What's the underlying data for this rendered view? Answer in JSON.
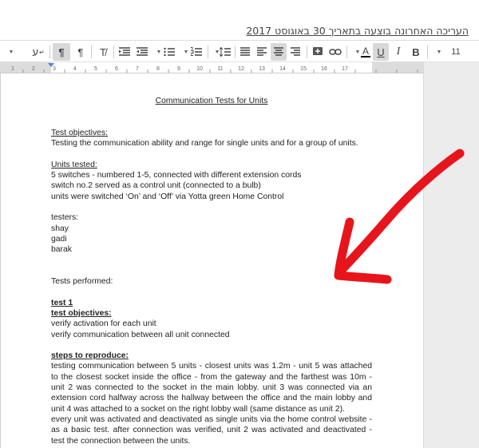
{
  "header": {
    "last_edit": "העריכה האחרונה בוצעה בתאריך 30 באוגוסט 2017"
  },
  "toolbar": {
    "font_size": "11",
    "bold": "B",
    "italic": "I",
    "underline": "U",
    "text_color": "A",
    "rtl": "ע",
    "pilcrow": "¶"
  },
  "ruler": {
    "markers": [
      "1",
      "2",
      "3",
      "4",
      "5",
      "6",
      "7",
      "8",
      "9",
      "10",
      "11",
      "12",
      "13",
      "14",
      "15",
      "16",
      "17"
    ]
  },
  "document": {
    "title": "Communication Tests for Units",
    "objectives_heading": "Test objectives:",
    "objectives_text": "Testing the communication ability and range for single units and for a group of units.",
    "units_heading": "Units tested:",
    "units_lines": [
      "5 switches - numbered 1-5, connected with different extension cords",
      "switch no.2 served as a control unit (connected to a bulb)",
      "units were switched ‘On’ and ‘Off’ via Yotta green Home Control"
    ],
    "testers_heading": "testers:",
    "testers": [
      "shay",
      "gadi",
      "barak"
    ],
    "performed_heading": "Tests performed:",
    "test1_heading": "test 1",
    "test1_objectives_heading": "test objectives:",
    "test1_objectives": [
      "verify activation for each unit",
      "verify communication between all unit connected"
    ],
    "steps_heading": "steps to reproduce:",
    "steps_para1": "testing communication between 5 units  - closest units was 1.2m - unit 5 was attached to the closest socket inside the office -  from the gateway and the farthest was 10m - unit 2 was connected to the socket in the main lobby. unit 3 was connected via an extension cord halfway across the hallway between the office and the main lobby and unit 4 was attached to a socket on the right lobby wall (same distance as unit 2).",
    "steps_para2": "every unit was activated and deactivated as single units via the home control website - as a basic test. after connection was verified, unit 2 was activated and deactivated - test the connection between the units."
  },
  "annotation": {
    "arrow_color": "#e8141c"
  }
}
